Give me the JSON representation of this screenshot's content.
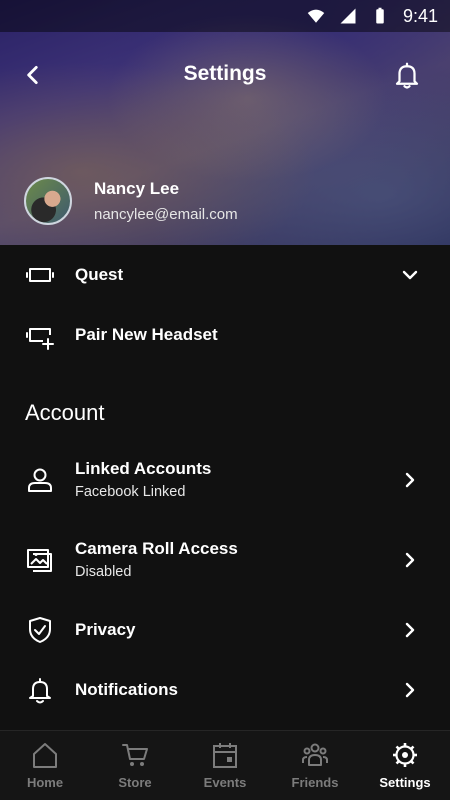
{
  "status": {
    "time": "9:41"
  },
  "header": {
    "title": "Settings"
  },
  "profile": {
    "name": "Nancy Lee",
    "email": "nancylee@email.com"
  },
  "devices": [
    {
      "label": "Quest",
      "icon": "headset-icon",
      "trailing": "chevron-down"
    },
    {
      "label": "Pair New Headset",
      "icon": "add-headset-icon"
    }
  ],
  "account": {
    "title": "Account",
    "items": [
      {
        "label": "Linked Accounts",
        "sub": "Facebook Linked",
        "icon": "person-icon"
      },
      {
        "label": "Camera Roll Access",
        "sub": "Disabled",
        "icon": "gallery-icon"
      },
      {
        "label": "Privacy",
        "icon": "shield-icon"
      },
      {
        "label": "Notifications",
        "icon": "bell-icon"
      }
    ]
  },
  "tabs": [
    {
      "label": "Home",
      "icon": "home-icon"
    },
    {
      "label": "Store",
      "icon": "cart-icon"
    },
    {
      "label": "Events",
      "icon": "calendar-icon"
    },
    {
      "label": "Friends",
      "icon": "friends-icon"
    },
    {
      "label": "Settings",
      "icon": "gear-icon",
      "active": true
    }
  ],
  "colors": {
    "background": "#111111",
    "tabbar": "#151515",
    "inactive_tab": "#7c7c7c",
    "active_tab": "#ffffff"
  }
}
